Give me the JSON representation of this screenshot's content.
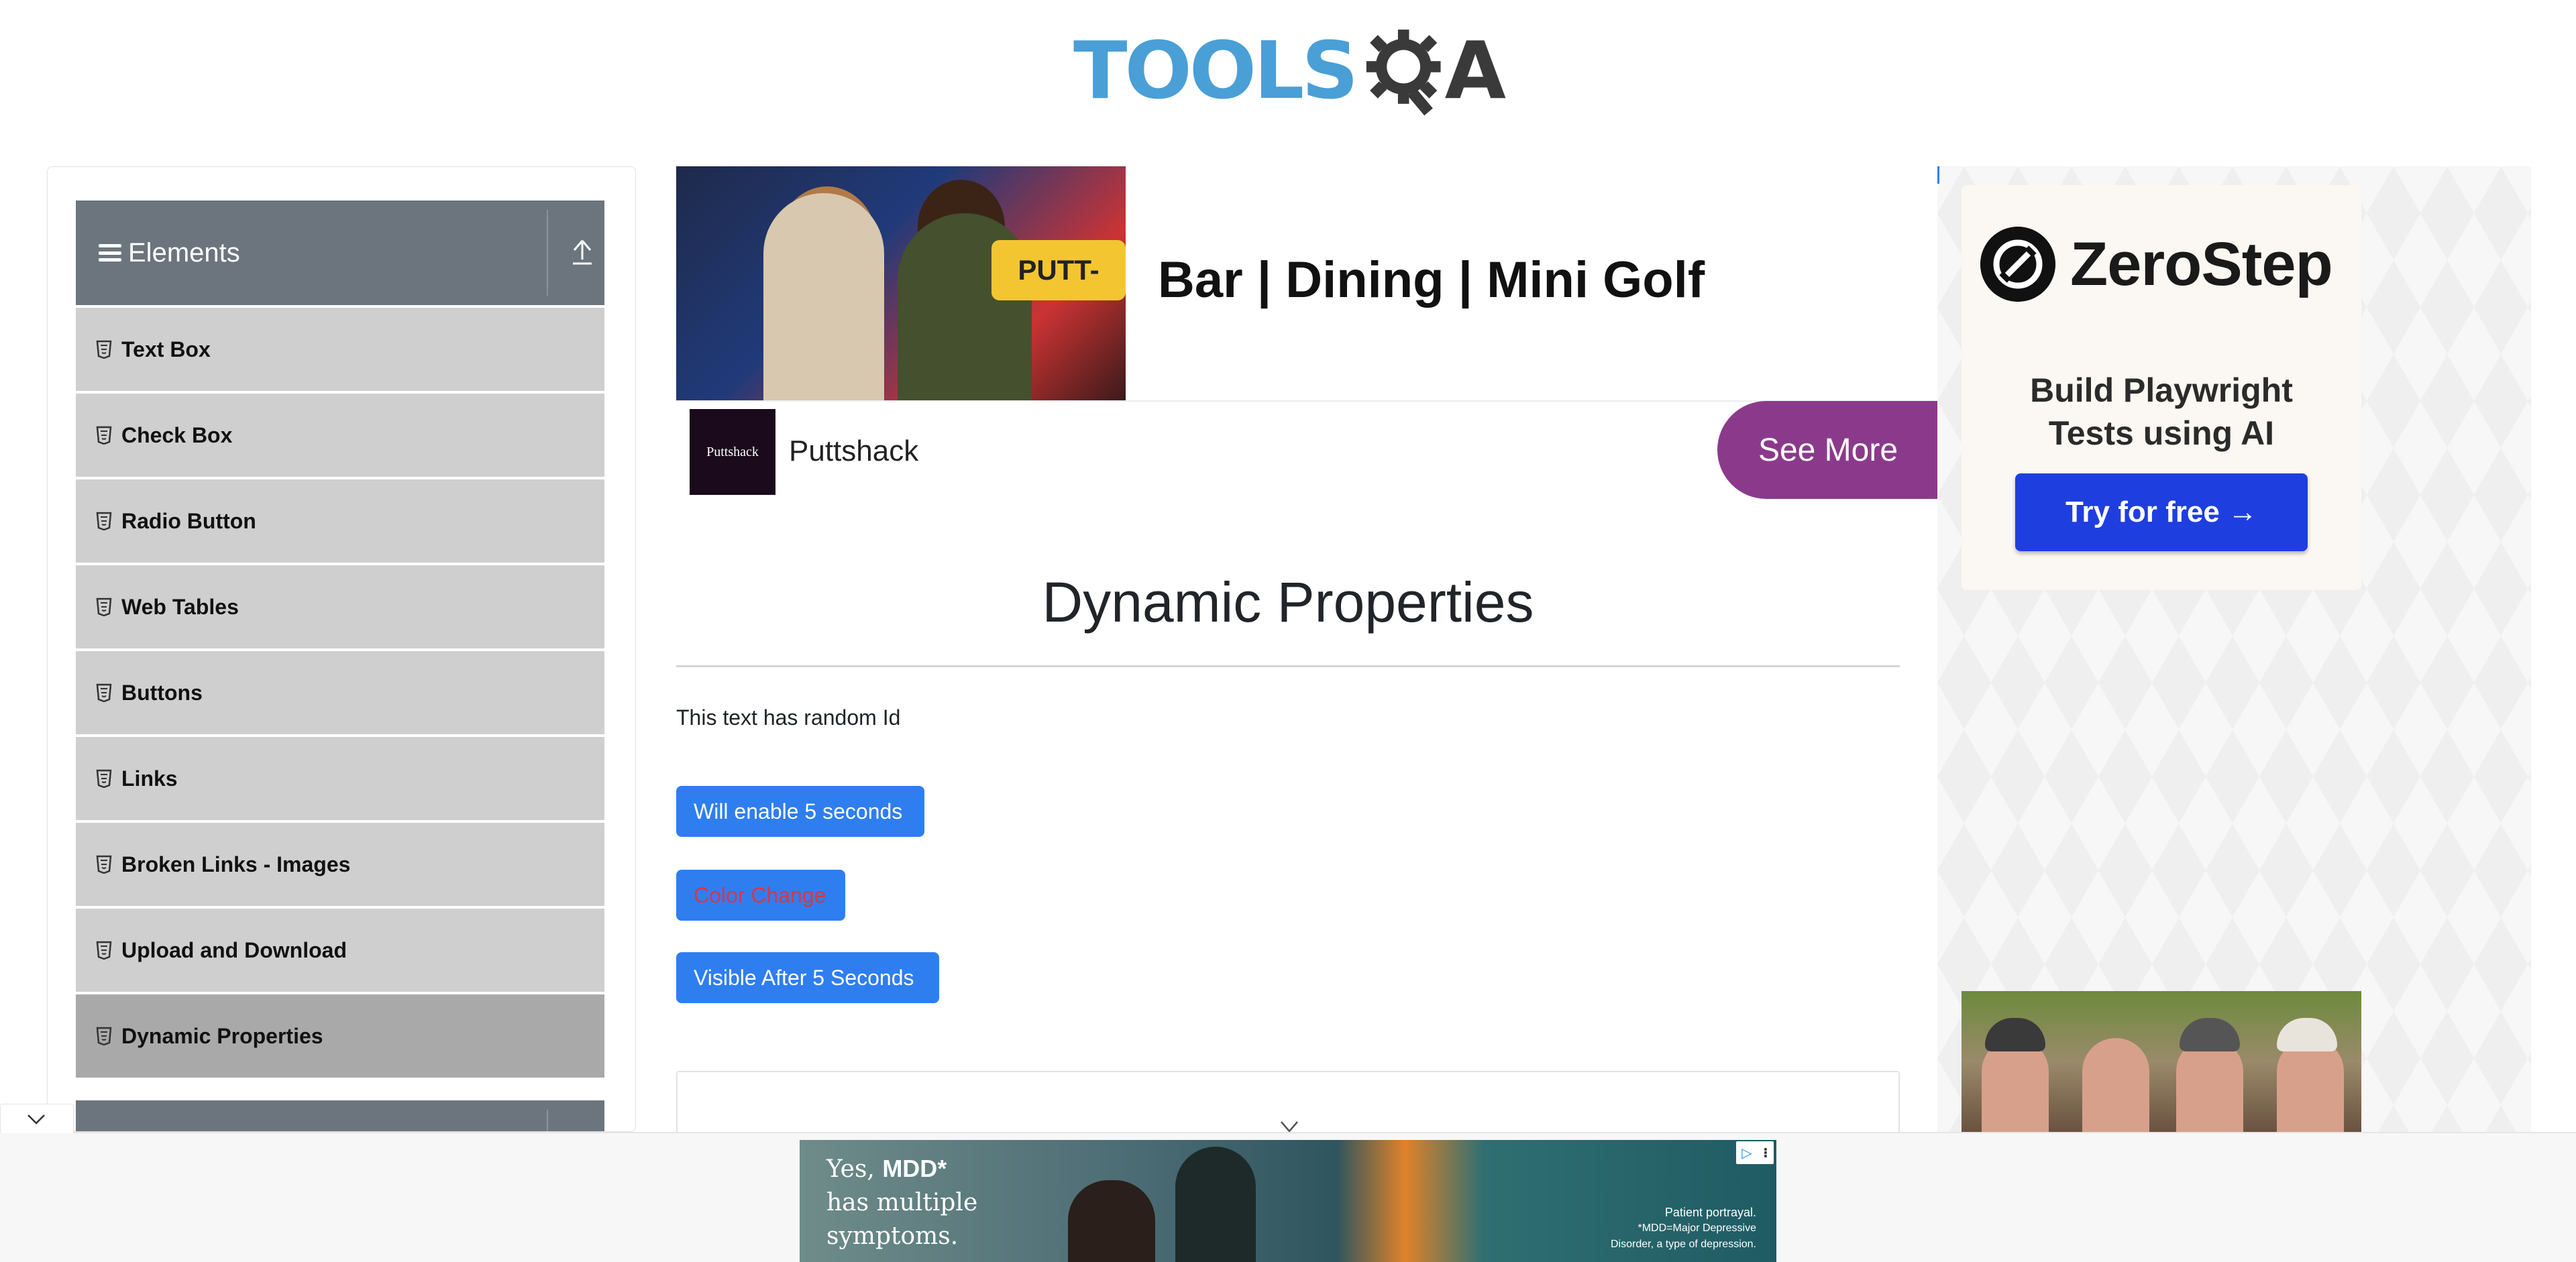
{
  "header": {
    "logo_text_left": "TOOLS",
    "logo_text_right": "A"
  },
  "sidebar": {
    "group_title": "Elements",
    "items": [
      {
        "label": "Text Box",
        "active": false
      },
      {
        "label": "Check Box",
        "active": false
      },
      {
        "label": "Radio Button",
        "active": false
      },
      {
        "label": "Web Tables",
        "active": false
      },
      {
        "label": "Buttons",
        "active": false
      },
      {
        "label": "Links",
        "active": false
      },
      {
        "label": "Broken Links - Images",
        "active": false
      },
      {
        "label": "Upload and Download",
        "active": false
      },
      {
        "label": "Dynamic Properties",
        "active": true
      }
    ]
  },
  "ad_top": {
    "headline": "Bar | Dining | Mini Golf",
    "brand_logo_text": "Puttshack",
    "brand_name": "Puttshack",
    "cta": "See More",
    "sign_text": "PUTT-"
  },
  "main": {
    "title": "Dynamic Properties",
    "random_text": "This text has random Id",
    "buttons": {
      "enable": "Will enable 5 seconds",
      "color_change": "Color Change",
      "visible_after": "Visible After 5 Seconds"
    }
  },
  "ad_right": {
    "brand": "ZeroStep",
    "tagline_line1": "Build Playwright",
    "tagline_line2": "Tests using AI",
    "cta": "Try for free →"
  },
  "ad_bottom": {
    "line1_prefix": "Yes, ",
    "line1_bold": "MDD*",
    "line2": "has multiple",
    "line3": "symptoms.",
    "fine_portrayal": "Patient portrayal.",
    "fine_note1": "*MDD=Major Depressive",
    "fine_note2": "Disorder, a type of depression."
  },
  "colors": {
    "accent_button": "#2f7ef0",
    "sidebar_header": "#6c757d",
    "sidebar_item": "#cfcfcf",
    "sidebar_item_active": "#a9a9a9",
    "ad_cta": "#8b3a8b",
    "zerostep_button": "#1f3ee0",
    "color_change_text": "#dc3545"
  },
  "icons": {
    "sidebar_group": "hamburger-icon",
    "sidebar_collapse": "upload-arrow-icon",
    "sidebar_item": "html5-shield-icon",
    "card_expand": "chevron-down-icon",
    "bottom_collapse": "chevron-down-icon"
  }
}
